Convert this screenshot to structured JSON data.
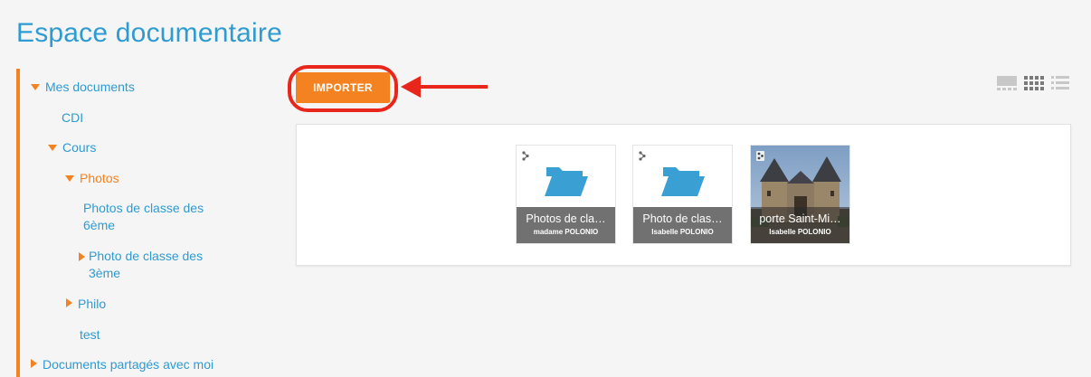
{
  "page": {
    "title": "Espace documentaire"
  },
  "sidebar": {
    "items": [
      {
        "label": "Mes documents",
        "state": "expanded",
        "active": false
      },
      {
        "label": "CDI",
        "state": "leaf",
        "active": false
      },
      {
        "label": "Cours",
        "state": "expanded",
        "active": false
      },
      {
        "label": "Photos",
        "state": "expanded",
        "active": true
      },
      {
        "label": "Photos de classe des 6ème",
        "state": "leaf",
        "active": false
      },
      {
        "label": "Photo de classe des 3ème",
        "state": "collapsed",
        "active": false
      },
      {
        "label": "Philo",
        "state": "collapsed",
        "active": false
      },
      {
        "label": "test",
        "state": "leaf",
        "active": false
      },
      {
        "label": "Documents partagés avec moi",
        "state": "collapsed",
        "active": false
      }
    ]
  },
  "toolbar": {
    "import_label": "IMPORTER",
    "view_modes": [
      "large-thumbnails-icon",
      "grid-icon",
      "list-icon"
    ]
  },
  "files": [
    {
      "title": "Photos de cla…",
      "author": "madame POLONIO",
      "kind": "folder",
      "share_icon": "shared-icon"
    },
    {
      "title": "Photo de clas…",
      "author": "Isabelle POLONIO",
      "kind": "folder",
      "share_icon": "shared-icon"
    },
    {
      "title": "porte Saint-Mi…",
      "author": "Isabelle POLONIO",
      "kind": "image",
      "share_icon": "shared-icon"
    }
  ],
  "colors": {
    "accent": "#f58220",
    "link": "#2e9bd1",
    "annotation": "#e8261c",
    "folder": "#3aa0d4"
  }
}
